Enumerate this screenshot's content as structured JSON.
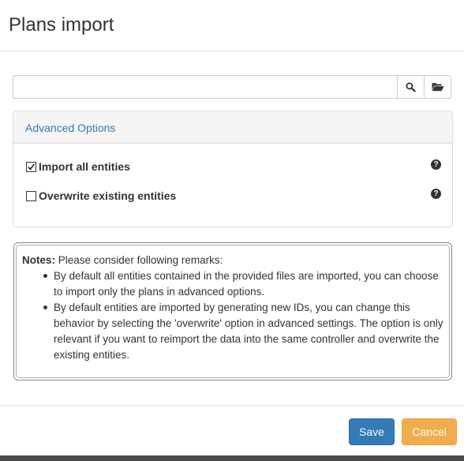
{
  "dialog": {
    "title": "Plans import"
  },
  "file_input": {
    "value": "",
    "placeholder": "",
    "search_icon": "search-icon",
    "folder_icon": "folder-open-icon"
  },
  "advanced": {
    "heading": "Advanced Options",
    "options": [
      {
        "label": "Import all entities",
        "checked": true
      },
      {
        "label": "Overwrite existing entities",
        "checked": false
      }
    ]
  },
  "notes": {
    "title": "Notes:",
    "intro": " Please consider following remarks:",
    "items": [
      "By default all entities contained in the provided files are imported, you can choose to import only the plans in advanced options.",
      "By default entities are imported by generating new IDs, you can change this behavior by selecting the 'overwrite' option in advanced settings. The option is only relevant if you want to reimport the data into the same controller and overwrite the existing entities."
    ]
  },
  "footer": {
    "save_label": "Save",
    "cancel_label": "Cancel"
  },
  "colors": {
    "primary": "#337ab7",
    "warning": "#f0ad4e",
    "link": "#337ab7"
  }
}
